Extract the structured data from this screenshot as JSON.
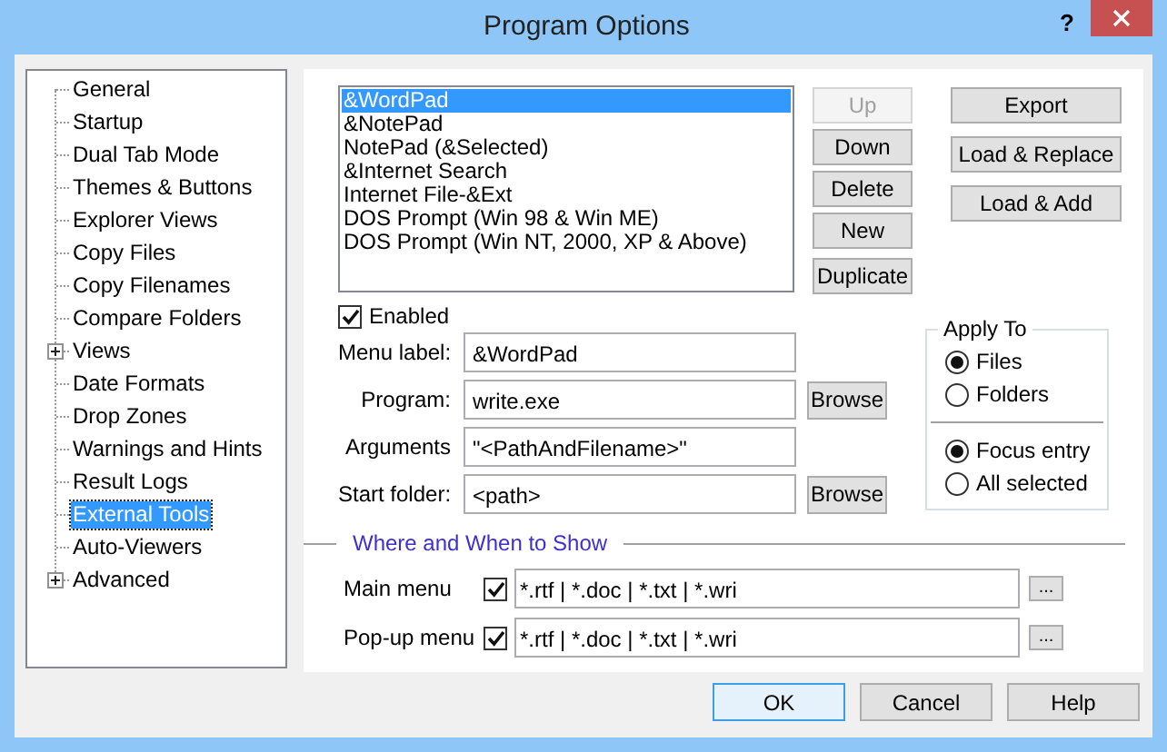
{
  "window": {
    "title": "Program Options",
    "help_button": "?"
  },
  "tree": [
    {
      "label": "General",
      "kind": "page",
      "selected": false
    },
    {
      "label": "Startup",
      "kind": "page",
      "selected": false
    },
    {
      "label": "Dual Tab Mode",
      "kind": "page",
      "selected": false
    },
    {
      "label": "Themes & Buttons",
      "kind": "page",
      "selected": false
    },
    {
      "label": "Explorer Views",
      "kind": "page",
      "selected": false
    },
    {
      "label": "Copy Files",
      "kind": "page",
      "selected": false
    },
    {
      "label": "Copy Filenames",
      "kind": "page",
      "selected": false
    },
    {
      "label": "Compare Folders",
      "kind": "page",
      "selected": false
    },
    {
      "label": "Views",
      "kind": "group",
      "selected": false
    },
    {
      "label": "Date Formats",
      "kind": "page",
      "selected": false
    },
    {
      "label": "Drop Zones",
      "kind": "page",
      "selected": false
    },
    {
      "label": "Warnings and Hints",
      "kind": "page",
      "selected": false
    },
    {
      "label": "Result Logs",
      "kind": "page",
      "selected": false
    },
    {
      "label": "External Tools",
      "kind": "page",
      "selected": true
    },
    {
      "label": "Auto-Viewers",
      "kind": "page",
      "selected": false
    },
    {
      "label": "Advanced",
      "kind": "group",
      "selected": false
    }
  ],
  "tools": {
    "items": [
      {
        "label": "&WordPad",
        "selected": true
      },
      {
        "label": "&NotePad",
        "selected": false
      },
      {
        "label": "NotePad (&Selected)",
        "selected": false
      },
      {
        "label": "&Internet Search",
        "selected": false
      },
      {
        "label": "Internet File-&Ext",
        "selected": false
      },
      {
        "label": "DOS Prompt (Win 98 & Win ME)",
        "selected": false
      },
      {
        "label": "DOS Prompt (Win NT, 2000, XP & Above)",
        "selected": false
      }
    ],
    "buttons": [
      {
        "label": "Up",
        "disabled": true
      },
      {
        "label": "Down",
        "disabled": false
      },
      {
        "label": "Delete",
        "disabled": false
      },
      {
        "label": "New",
        "disabled": false
      },
      {
        "label": "Duplicate",
        "disabled": false
      }
    ]
  },
  "file_buttons": [
    "Export",
    "Load & Replace",
    "Load & Add"
  ],
  "enabled": {
    "label": "Enabled",
    "checked": true
  },
  "fields": [
    {
      "label": "Menu label:",
      "value": "&WordPad"
    },
    {
      "label": "Program:",
      "value": "write.exe",
      "browse": "Browse"
    },
    {
      "label": "Arguments",
      "value": "\"<PathAndFilename>\""
    },
    {
      "label": "Start folder:",
      "value": "<path>",
      "browse": "Browse"
    }
  ],
  "apply_to": {
    "title": "Apply To",
    "targets": [
      {
        "label": "Files",
        "selected": true
      },
      {
        "label": "Folders",
        "selected": false
      }
    ],
    "scope": [
      {
        "label": "Focus entry",
        "selected": true
      },
      {
        "label": "All selected",
        "selected": false
      }
    ]
  },
  "show": {
    "title": "Where and When to Show",
    "rows": [
      {
        "label": "Main menu",
        "checked": true,
        "value": "*.rtf | *.doc | *.txt | *.wri",
        "button": "..."
      },
      {
        "label": "Pop-up menu",
        "checked": true,
        "value": "*.rtf | *.doc | *.txt | *.wri",
        "button": "..."
      }
    ]
  },
  "dialog_buttons": [
    {
      "label": "OK",
      "default": true
    },
    {
      "label": "Cancel",
      "default": false
    },
    {
      "label": "Help",
      "default": false
    }
  ]
}
